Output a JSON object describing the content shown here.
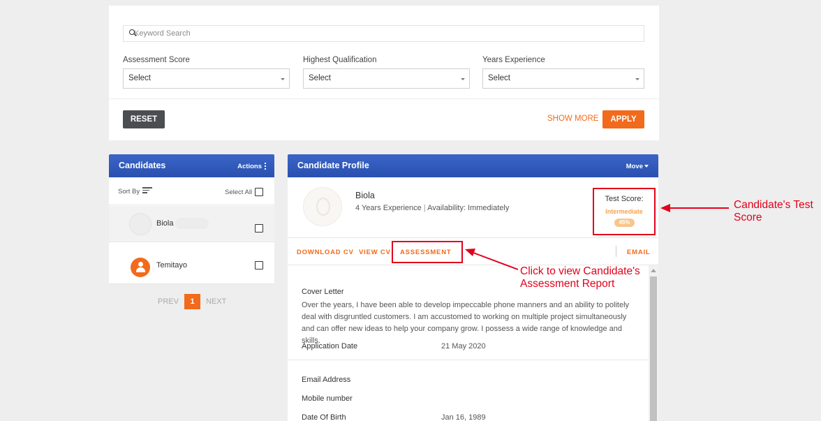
{
  "filters": {
    "search_placeholder": "Keyword Search",
    "assessment_score": {
      "label": "Assessment Score",
      "value": "Select"
    },
    "highest_qualification": {
      "label": "Highest Qualification",
      "value": "Select"
    },
    "years_experience": {
      "label": "Years Experience",
      "value": "Select"
    },
    "reset_label": "RESET",
    "show_more_label": "SHOW MORE",
    "apply_label": "APPLY"
  },
  "candidates": {
    "title": "Candidates",
    "actions_label": "Actions",
    "sort_by_label": "Sort By",
    "select_all_label": "Select All",
    "items": [
      {
        "name": "Biola",
        "selected": true
      },
      {
        "name": "Temitayo",
        "selected": false
      }
    ]
  },
  "pagination": {
    "prev_label": "PREV",
    "current_page": "1",
    "next_label": "NEXT"
  },
  "profile": {
    "title": "Candidate Profile",
    "move_label": "Move",
    "name": "Biola",
    "experience": "4 Years Experience",
    "availability": "Availability: Immediately",
    "test_score": {
      "label": "Test Score:",
      "level": "Intermediate",
      "percent": "45%"
    },
    "tabs": {
      "download_cv": "DOWNLOAD CV",
      "view_cv": "VIEW CV",
      "assessment": "ASSESSMENT",
      "email": "EMAIL"
    },
    "cover_letter_label": "Cover Letter",
    "cover_letter_text": "Over the years, I have been able to develop impeccable phone manners and an ability to politely deal with disgruntled customers. I am accustomed to working on multiple project simultaneously and can offer new ideas to help your company grow. I possess a wide range of knowledge and skills.",
    "application_date_label": "Application Date",
    "application_date_value": "21 May 2020",
    "email_address_label": "Email Address",
    "mobile_number_label": "Mobile number",
    "date_of_birth_label": "Date Of Birth",
    "date_of_birth_value": "Jan 16, 1989"
  },
  "annotations": {
    "test_score_note_line1": "Candidate's Test",
    "test_score_note_line2": "Score",
    "assessment_note_line1": "Click to view Candidate's",
    "assessment_note_line2": "Assessment Report"
  },
  "colors": {
    "accent": "#f26a1b",
    "header_blue": "#2f58bb",
    "annotation_red": "#e2001a"
  }
}
